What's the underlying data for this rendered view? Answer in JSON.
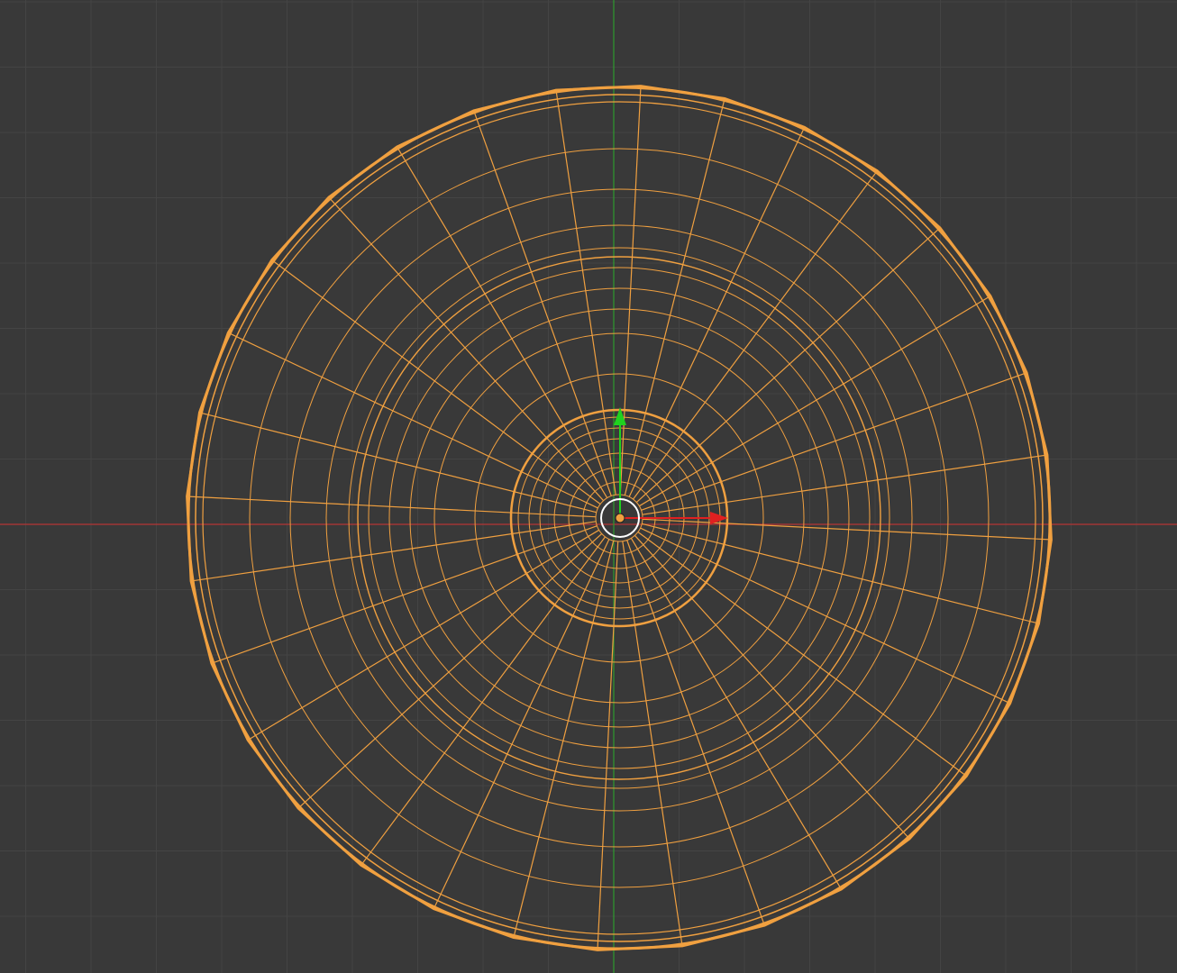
{
  "viewport": {
    "view": "top-orthographic",
    "background_color": "#393939",
    "grid_color": "#444444",
    "x_axis_color": "#c03a3a",
    "y_axis_color": "#2f9a2f",
    "selection_color": "#f0a040"
  },
  "object": {
    "type": "wireframe-mesh",
    "shape": "radial-dish",
    "selected": true,
    "radial_segments": 32
  },
  "gizmo": {
    "type": "translate",
    "x_arrow_color": "#e02020",
    "y_arrow_color": "#20c020",
    "pivot_icon": "object-origin-icon"
  }
}
